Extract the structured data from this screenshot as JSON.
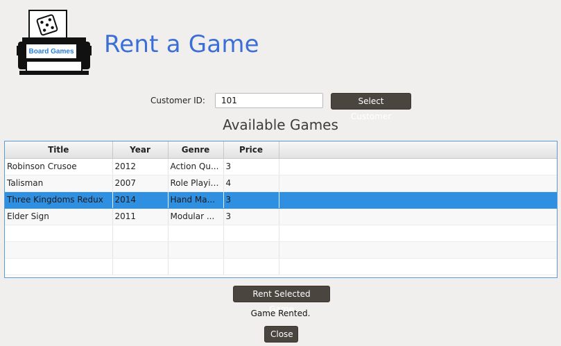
{
  "app": {
    "title": "Rent a Game",
    "logo_text": "Board Games"
  },
  "customer": {
    "label": "Customer ID:",
    "value": "101",
    "button_label": "Select Customer"
  },
  "games": {
    "heading": "Available Games",
    "columns": [
      "Title",
      "Year",
      "Genre",
      "Price"
    ],
    "rows": [
      {
        "title": "Robinson Crusoe",
        "year": "2012",
        "genre": "Action Qu...",
        "price": "3"
      },
      {
        "title": "Talisman",
        "year": "2007",
        "genre": "Role Playing",
        "price": "4"
      },
      {
        "title": "Three Kingdoms Redux",
        "year": "2014",
        "genre": "Hand Ma...",
        "price": "3"
      },
      {
        "title": "Elder Sign",
        "year": "2011",
        "genre": "Modular ...",
        "price": "3"
      }
    ],
    "selected_index": 2
  },
  "actions": {
    "rent_label": "Rent Selected Game",
    "status_text": "Game Rented.",
    "close_label": "Close"
  },
  "colors": {
    "title": "#3b6fd6",
    "selection": "#2f8fe0",
    "button": "#4b4540",
    "background": "#f1efee"
  }
}
